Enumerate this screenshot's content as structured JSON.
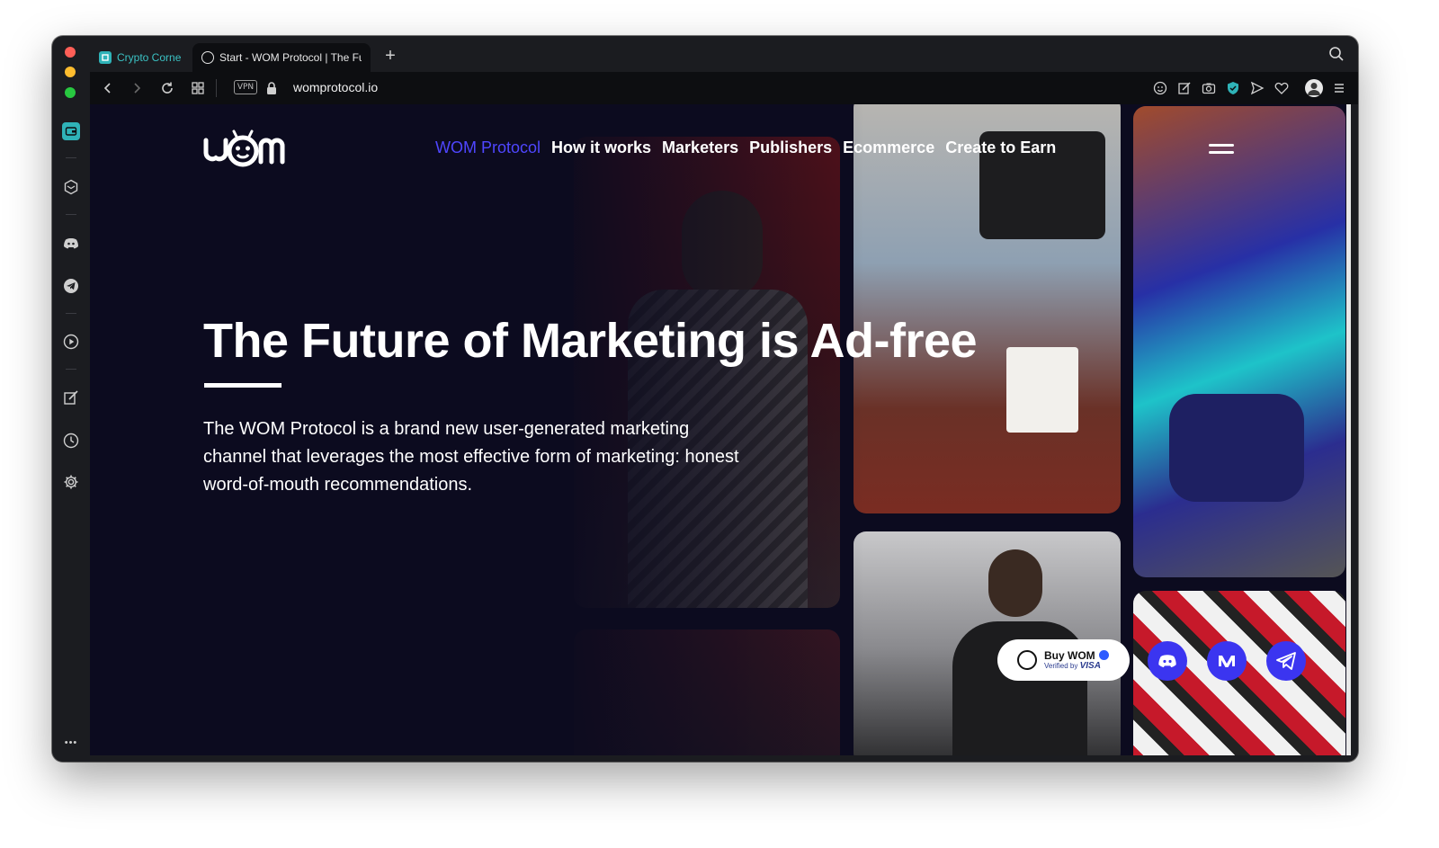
{
  "browser": {
    "tabs": [
      {
        "label": "Crypto Corne",
        "active": false
      },
      {
        "label": "Start - WOM Protocol | The Fu",
        "active": true
      }
    ],
    "new_tab": "+",
    "url": "womprotocol.io",
    "vpn_label": "VPN",
    "sidebar_icons": [
      "wallet-icon",
      "crypto-icon",
      "discord-icon",
      "telegram-icon",
      "player-icon",
      "pinboard-icon",
      "history-icon",
      "settings-icon"
    ],
    "sidebar_more": "•••"
  },
  "page": {
    "nav": {
      "items": [
        {
          "label": "WOM Protocol",
          "active": true
        },
        {
          "label": "How it works",
          "active": false
        },
        {
          "label": "Marketers",
          "active": false
        },
        {
          "label": "Publishers",
          "active": false
        },
        {
          "label": "Ecommerce",
          "active": false
        },
        {
          "label": "Create to Earn",
          "active": false
        }
      ]
    },
    "hero": {
      "title": "The Future of Marketing is Ad-free",
      "body": "The WOM Protocol is a brand new user-generated marketing channel that leverages the most effective form of marketing: honest word-of-mouth recommendations."
    },
    "buy": {
      "label": "Buy WOM",
      "sub_prefix": "Verified by",
      "sub_brand": "VISA"
    },
    "colors": {
      "accent": "#4f46ff",
      "background": "#0c0b1f",
      "social_button": "#3b35f0"
    }
  }
}
